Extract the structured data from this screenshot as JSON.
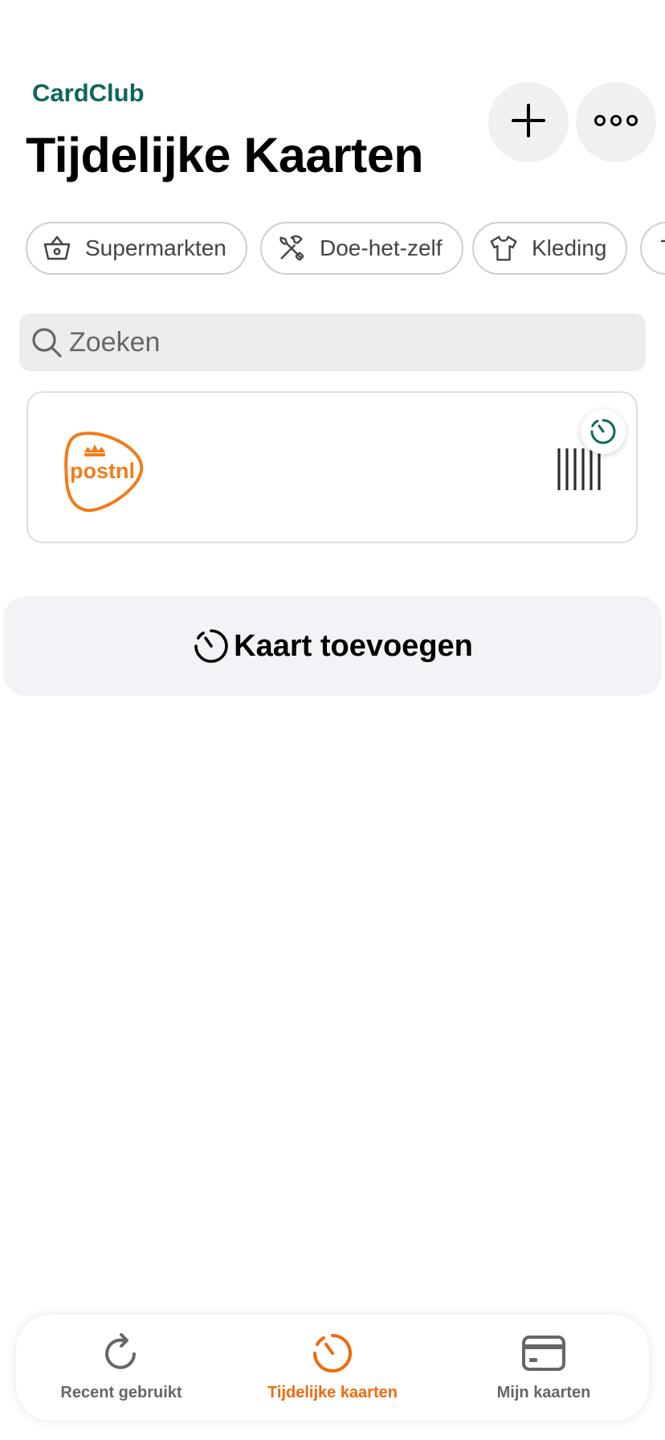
{
  "header": {
    "app_name": "CardClub",
    "title": "Tijdelijke Kaarten"
  },
  "actions": {
    "add_icon": "plus-icon",
    "more_icon": "ellipsis-icon"
  },
  "categories": [
    {
      "label": "Supermarkten",
      "icon": "basket-icon"
    },
    {
      "label": "Doe-het-zelf",
      "icon": "tools-icon"
    },
    {
      "label": "Kleding",
      "icon": "shirt-icon"
    }
  ],
  "search": {
    "placeholder": "Zoeken",
    "value": ""
  },
  "cards": [
    {
      "brand": "postnl",
      "crown": "crown-icon",
      "has_timer_badge": true,
      "accent": "#f07d1a"
    }
  ],
  "add_card_button": {
    "label": "Kaart toevoegen",
    "icon": "timer-icon"
  },
  "tabbar": {
    "items": [
      {
        "label": "Recent gebruikt",
        "icon": "refresh-icon",
        "active": false
      },
      {
        "label": "Tijdelijke kaarten",
        "icon": "timer-icon",
        "active": true
      },
      {
        "label": "Mijn kaarten",
        "icon": "card-icon",
        "active": false
      }
    ]
  },
  "colors": {
    "brand_green": "#11665c",
    "active_orange": "#f06a0c",
    "postnl_orange": "#f07d1a"
  }
}
